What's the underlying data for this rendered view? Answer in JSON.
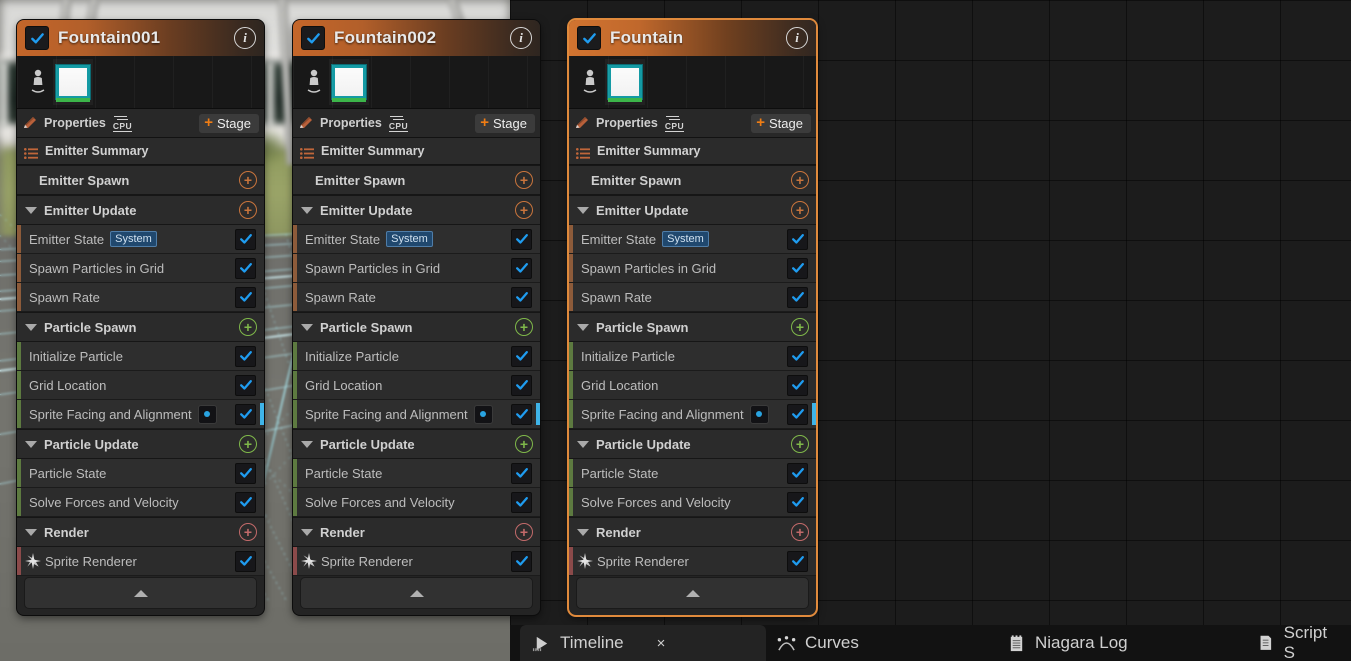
{
  "viewport": {
    "name": "niagara-preview-viewport",
    "description": "Blurred outdoor photo backdrop with cyan particle grid simulation"
  },
  "emitters": [
    {
      "title": "Fountain001",
      "enabled": true,
      "selected": false,
      "info_icon": "info-icon",
      "stage_button": "Stage",
      "properties_label": "Properties",
      "sim_target": "CPU",
      "summary_label": "Emitter Summary",
      "sections": [
        {
          "type": "stage",
          "label": "Emitter Spawn",
          "collapsed": true,
          "add_color": "orange"
        },
        {
          "type": "stage",
          "label": "Emitter Update",
          "collapsed": false,
          "add_color": "orange"
        },
        {
          "type": "module",
          "label": "Emitter State",
          "badge": "System",
          "checked": true,
          "bar": "orange"
        },
        {
          "type": "module",
          "label": "Spawn Particles in Grid",
          "checked": true,
          "bar": "orange"
        },
        {
          "type": "module",
          "label": "Spawn Rate",
          "checked": true,
          "bar": "orange"
        },
        {
          "type": "stage",
          "label": "Particle Spawn",
          "collapsed": false,
          "add_color": "green"
        },
        {
          "type": "module",
          "label": "Initialize Particle",
          "checked": true,
          "bar": "green"
        },
        {
          "type": "module",
          "label": "Grid Location",
          "checked": true,
          "bar": "green"
        },
        {
          "type": "module",
          "label": "Sprite Facing and Alignment",
          "checked": true,
          "bar": "green",
          "dot": true,
          "highlight": true
        },
        {
          "type": "stage",
          "label": "Particle Update",
          "collapsed": false,
          "add_color": "green"
        },
        {
          "type": "module",
          "label": "Particle State",
          "checked": true,
          "bar": "green"
        },
        {
          "type": "module",
          "label": "Solve Forces and Velocity",
          "checked": true,
          "bar": "green"
        },
        {
          "type": "stage",
          "label": "Render",
          "collapsed": false,
          "add_color": "red"
        },
        {
          "type": "renderer",
          "label": "Sprite Renderer",
          "checked": true,
          "bar": "red",
          "icon": "sprite-star-icon"
        }
      ]
    },
    {
      "title": "Fountain002",
      "enabled": true,
      "selected": false,
      "info_icon": "info-icon",
      "stage_button": "Stage",
      "properties_label": "Properties",
      "sim_target": "CPU",
      "summary_label": "Emitter Summary",
      "sections": [
        {
          "type": "stage",
          "label": "Emitter Spawn",
          "collapsed": true,
          "add_color": "orange"
        },
        {
          "type": "stage",
          "label": "Emitter Update",
          "collapsed": false,
          "add_color": "orange"
        },
        {
          "type": "module",
          "label": "Emitter State",
          "badge": "System",
          "checked": true,
          "bar": "orange"
        },
        {
          "type": "module",
          "label": "Spawn Particles in Grid",
          "checked": true,
          "bar": "orange"
        },
        {
          "type": "module",
          "label": "Spawn Rate",
          "checked": true,
          "bar": "orange"
        },
        {
          "type": "stage",
          "label": "Particle Spawn",
          "collapsed": false,
          "add_color": "green"
        },
        {
          "type": "module",
          "label": "Initialize Particle",
          "checked": true,
          "bar": "green"
        },
        {
          "type": "module",
          "label": "Grid Location",
          "checked": true,
          "bar": "green"
        },
        {
          "type": "module",
          "label": "Sprite Facing and Alignment",
          "checked": true,
          "bar": "green",
          "dot": true,
          "highlight": true
        },
        {
          "type": "stage",
          "label": "Particle Update",
          "collapsed": false,
          "add_color": "green"
        },
        {
          "type": "module",
          "label": "Particle State",
          "checked": true,
          "bar": "green"
        },
        {
          "type": "module",
          "label": "Solve Forces and Velocity",
          "checked": true,
          "bar": "green"
        },
        {
          "type": "stage",
          "label": "Render",
          "collapsed": false,
          "add_color": "red"
        },
        {
          "type": "renderer",
          "label": "Sprite Renderer",
          "checked": true,
          "bar": "red",
          "icon": "sprite-star-icon"
        }
      ]
    },
    {
      "title": "Fountain",
      "enabled": true,
      "selected": true,
      "info_icon": "info-icon",
      "stage_button": "Stage",
      "properties_label": "Properties",
      "sim_target": "CPU",
      "summary_label": "Emitter Summary",
      "sections": [
        {
          "type": "stage",
          "label": "Emitter Spawn",
          "collapsed": true,
          "add_color": "orange"
        },
        {
          "type": "stage",
          "label": "Emitter Update",
          "collapsed": false,
          "add_color": "orange"
        },
        {
          "type": "module",
          "label": "Emitter State",
          "badge": "System",
          "checked": true,
          "bar": "orange"
        },
        {
          "type": "module",
          "label": "Spawn Particles in Grid",
          "checked": true,
          "bar": "orange"
        },
        {
          "type": "module",
          "label": "Spawn Rate",
          "checked": true,
          "bar": "orange"
        },
        {
          "type": "stage",
          "label": "Particle Spawn",
          "collapsed": false,
          "add_color": "green"
        },
        {
          "type": "module",
          "label": "Initialize Particle",
          "checked": true,
          "bar": "green"
        },
        {
          "type": "module",
          "label": "Grid Location",
          "checked": true,
          "bar": "green"
        },
        {
          "type": "module",
          "label": "Sprite Facing and Alignment",
          "checked": true,
          "bar": "green",
          "dot": true,
          "highlight": true
        },
        {
          "type": "stage",
          "label": "Particle Update",
          "collapsed": false,
          "add_color": "green"
        },
        {
          "type": "module",
          "label": "Particle State",
          "checked": true,
          "bar": "green"
        },
        {
          "type": "module",
          "label": "Solve Forces and Velocity",
          "checked": true,
          "bar": "green"
        },
        {
          "type": "stage",
          "label": "Render",
          "collapsed": false,
          "add_color": "red"
        },
        {
          "type": "renderer",
          "label": "Sprite Renderer",
          "checked": true,
          "bar": "red",
          "icon": "sprite-star-icon"
        }
      ]
    }
  ],
  "bottom_tabs": [
    {
      "label": "Timeline",
      "icon": "play-timeline-icon",
      "active": true,
      "closable": true,
      "close_label": "×"
    },
    {
      "label": "Curves",
      "icon": "curve-icon",
      "active": false,
      "closable": false
    },
    {
      "label": "Niagara Log",
      "icon": "log-icon",
      "active": false,
      "closable": false
    },
    {
      "label": "Script S",
      "icon": "script-icon",
      "active": false,
      "closable": false
    }
  ],
  "colors": {
    "header_orange": "#c4662a",
    "accent_orange": "#f07d14",
    "checkbox_blue": "#1f9cf0",
    "stage_green": "#7fb84a",
    "stage_red": "#c26a6a",
    "particle_cyan": "#9fe8ef"
  }
}
